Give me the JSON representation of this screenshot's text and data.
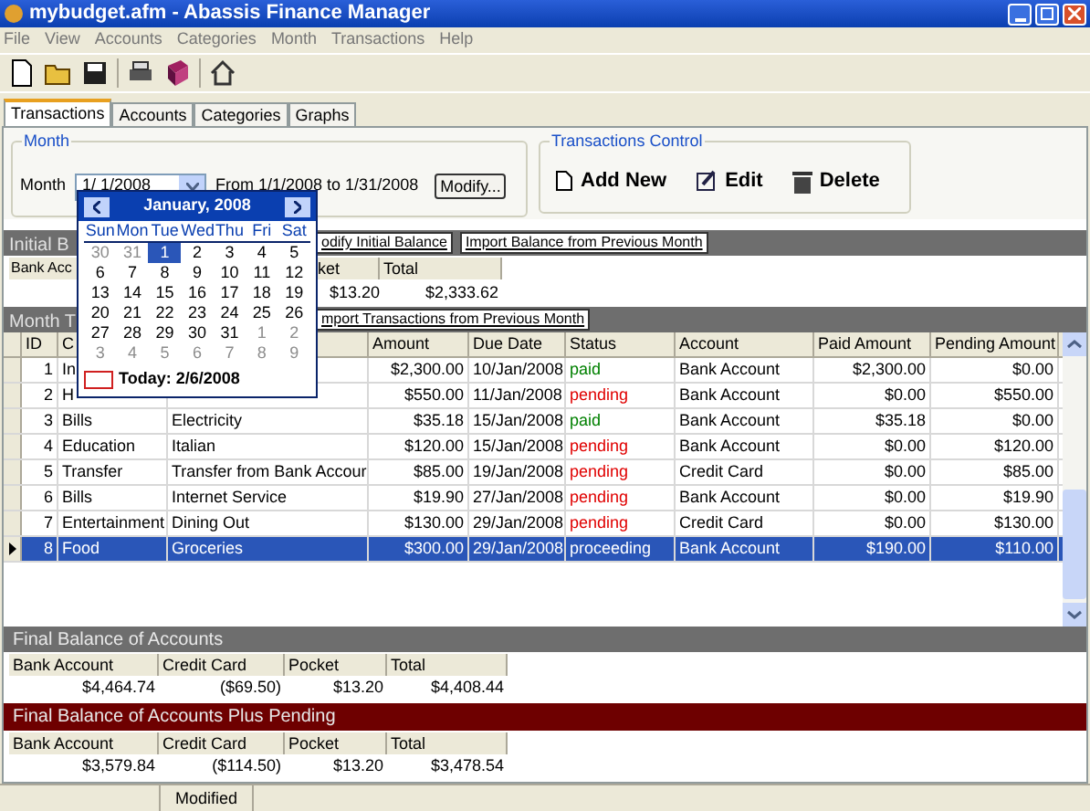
{
  "window": {
    "title": "mybudget.afm - Abassis Finance Manager"
  },
  "menu": [
    "File",
    "View",
    "Accounts",
    "Categories",
    "Month",
    "Transactions",
    "Help"
  ],
  "tabs": [
    {
      "label": "Transactions",
      "selected": true
    },
    {
      "label": "Accounts",
      "selected": false
    },
    {
      "label": "Categories",
      "selected": false
    },
    {
      "label": "Graphs",
      "selected": false
    }
  ],
  "month_group": {
    "title": "Month",
    "label": "Month",
    "value": "1/ 1/2008",
    "range": "From 1/1/2008 to 1/31/2008",
    "modify": "Modify..."
  },
  "transactions_control": {
    "title": "Transactions Control",
    "buttons": [
      {
        "kind": "add",
        "label": "Add New"
      },
      {
        "kind": "edit",
        "label": "Edit"
      },
      {
        "kind": "delete",
        "label": "Delete"
      }
    ]
  },
  "calendar": {
    "title": "January, 2008",
    "weekdays": [
      "Sun",
      "Mon",
      "Tue",
      "Wed",
      "Thu",
      "Fri",
      "Sat"
    ],
    "days": [
      {
        "d": "30",
        "other": true,
        "selected": false
      },
      {
        "d": "31",
        "other": true,
        "selected": false
      },
      {
        "d": "1",
        "other": false,
        "selected": true
      },
      {
        "d": "2",
        "other": false,
        "selected": false
      },
      {
        "d": "3",
        "other": false,
        "selected": false
      },
      {
        "d": "4",
        "other": false,
        "selected": false
      },
      {
        "d": "5",
        "other": false,
        "selected": false
      },
      {
        "d": "6",
        "other": false,
        "selected": false
      },
      {
        "d": "7",
        "other": false,
        "selected": false
      },
      {
        "d": "8",
        "other": false,
        "selected": false
      },
      {
        "d": "9",
        "other": false,
        "selected": false
      },
      {
        "d": "10",
        "other": false,
        "selected": false
      },
      {
        "d": "11",
        "other": false,
        "selected": false
      },
      {
        "d": "12",
        "other": false,
        "selected": false
      },
      {
        "d": "13",
        "other": false,
        "selected": false
      },
      {
        "d": "14",
        "other": false,
        "selected": false
      },
      {
        "d": "15",
        "other": false,
        "selected": false
      },
      {
        "d": "16",
        "other": false,
        "selected": false
      },
      {
        "d": "17",
        "other": false,
        "selected": false
      },
      {
        "d": "18",
        "other": false,
        "selected": false
      },
      {
        "d": "19",
        "other": false,
        "selected": false
      },
      {
        "d": "20",
        "other": false,
        "selected": false
      },
      {
        "d": "21",
        "other": false,
        "selected": false
      },
      {
        "d": "22",
        "other": false,
        "selected": false
      },
      {
        "d": "23",
        "other": false,
        "selected": false
      },
      {
        "d": "24",
        "other": false,
        "selected": false
      },
      {
        "d": "25",
        "other": false,
        "selected": false
      },
      {
        "d": "26",
        "other": false,
        "selected": false
      },
      {
        "d": "27",
        "other": false,
        "selected": false
      },
      {
        "d": "28",
        "other": false,
        "selected": false
      },
      {
        "d": "29",
        "other": false,
        "selected": false
      },
      {
        "d": "30",
        "other": false,
        "selected": false
      },
      {
        "d": "31",
        "other": false,
        "selected": false
      },
      {
        "d": "1",
        "other": true,
        "selected": false
      },
      {
        "d": "2",
        "other": true,
        "selected": false
      },
      {
        "d": "3",
        "other": true,
        "selected": false
      },
      {
        "d": "4",
        "other": true,
        "selected": false
      },
      {
        "d": "5",
        "other": true,
        "selected": false
      },
      {
        "d": "6",
        "other": true,
        "selected": false
      },
      {
        "d": "7",
        "other": true,
        "selected": false
      },
      {
        "d": "8",
        "other": true,
        "selected": false
      },
      {
        "d": "9",
        "other": true,
        "selected": false
      }
    ],
    "today": "Today: 2/6/2008"
  },
  "initial_balance": {
    "title": "Initial B",
    "buttons": [
      "odify Initial Balance",
      "Import Balance from Previous Month"
    ],
    "columns": [
      "Bank Acc",
      "ket",
      "Total"
    ],
    "values": [
      "$13.20",
      "$2,333.62"
    ]
  },
  "month_transactions": {
    "title": "Month T",
    "button": "mport Transactions from Previous Month",
    "columns": [
      "ID",
      "C",
      "Amount",
      "Due Date",
      "Status",
      "Account",
      "Paid Amount",
      "Pending Amount"
    ],
    "rows": [
      {
        "id": "1",
        "category": "In",
        "description": "",
        "amount": "$2,300.00",
        "due": "10/Jan/2008",
        "status": "paid",
        "color": "#008000",
        "account": "Bank Account",
        "paid": "$2,300.00",
        "pending": "$0.00",
        "selected": false
      },
      {
        "id": "2",
        "category": "H",
        "description": "",
        "amount": "$550.00",
        "due": "11/Jan/2008",
        "status": "pending",
        "color": "#e00000",
        "account": "Bank Account",
        "paid": "$0.00",
        "pending": "$550.00",
        "selected": false
      },
      {
        "id": "3",
        "category": "Bills",
        "description": "Electricity",
        "amount": "$35.18",
        "due": "15/Jan/2008",
        "status": "paid",
        "color": "#008000",
        "account": "Bank Account",
        "paid": "$35.18",
        "pending": "$0.00",
        "selected": false
      },
      {
        "id": "4",
        "category": "Education",
        "description": "Italian",
        "amount": "$120.00",
        "due": "15/Jan/2008",
        "status": "pending",
        "color": "#e00000",
        "account": "Bank Account",
        "paid": "$0.00",
        "pending": "$120.00",
        "selected": false
      },
      {
        "id": "5",
        "category": "Transfer",
        "description": "Transfer from Bank Accour",
        "amount": "$85.00",
        "due": "19/Jan/2008",
        "status": "pending",
        "color": "#e00000",
        "account": "Credit Card",
        "paid": "$0.00",
        "pending": "$85.00",
        "selected": false
      },
      {
        "id": "6",
        "category": "Bills",
        "description": "Internet Service",
        "amount": "$19.90",
        "due": "27/Jan/2008",
        "status": "pending",
        "color": "#e00000",
        "account": "Bank Account",
        "paid": "$0.00",
        "pending": "$19.90",
        "selected": false
      },
      {
        "id": "7",
        "category": "Entertainment",
        "description": "Dining Out",
        "amount": "$130.00",
        "due": "29/Jan/2008",
        "status": "pending",
        "color": "#e00000",
        "account": "Credit Card",
        "paid": "$0.00",
        "pending": "$130.00",
        "selected": false
      },
      {
        "id": "8",
        "category": "Food",
        "description": "Groceries",
        "amount": "$300.00",
        "due": "29/Jan/2008",
        "status": "proceeding",
        "account": "Bank Account",
        "paid": "$190.00",
        "pending": "$110.00",
        "selected": true
      }
    ]
  },
  "final_balance": {
    "title": "Final Balance of Accounts",
    "columns": [
      "Bank Account",
      "Credit Card",
      "Pocket",
      "Total"
    ],
    "values": [
      "$4,464.74",
      "($69.50)",
      "$13.20",
      "$4,408.44"
    ]
  },
  "final_balance_pending": {
    "title": "Final Balance of Accounts Plus Pending",
    "columns": [
      "Bank Account",
      "Credit Card",
      "Pocket",
      "Total"
    ],
    "values": [
      "$3,579.84",
      "($114.50)",
      "$13.20",
      "$3,478.54"
    ]
  },
  "status_bar": {
    "text": "Modified"
  }
}
